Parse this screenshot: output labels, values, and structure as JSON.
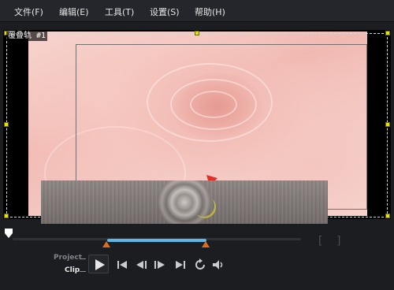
{
  "menu": {
    "items": [
      {
        "label": "文件(F)",
        "name": "menu-file"
      },
      {
        "label": "编辑(E)",
        "name": "menu-edit"
      },
      {
        "label": "工具(T)",
        "name": "menu-tools"
      },
      {
        "label": "设置(S)",
        "name": "menu-settings"
      },
      {
        "label": "帮助(H)",
        "name": "menu-help"
      }
    ]
  },
  "preview": {
    "track_label": "覆叠轨 #1"
  },
  "playback": {
    "mode_project": "Project",
    "mode_clip": "Clip",
    "active_mode": "Clip",
    "trim_start": 0.33,
    "trim_end": 0.65,
    "playhead": 0.0
  },
  "controls": [
    {
      "name": "play-button",
      "icon": "play-icon"
    },
    {
      "name": "go-to-start-button",
      "icon": "skip-to-start-icon"
    },
    {
      "name": "previous-frame-button",
      "icon": "step-back-icon"
    },
    {
      "name": "next-frame-button",
      "icon": "step-forward-icon"
    },
    {
      "name": "go-to-end-button",
      "icon": "skip-to-end-icon"
    },
    {
      "name": "repeat-button",
      "icon": "repeat-icon"
    },
    {
      "name": "volume-button",
      "icon": "speaker-icon"
    }
  ],
  "colors": {
    "accent": "#5fb7e6",
    "trim_marker": "#e06a1a",
    "handle": "#e8e000",
    "annotation_arrow": "#e0302a"
  }
}
